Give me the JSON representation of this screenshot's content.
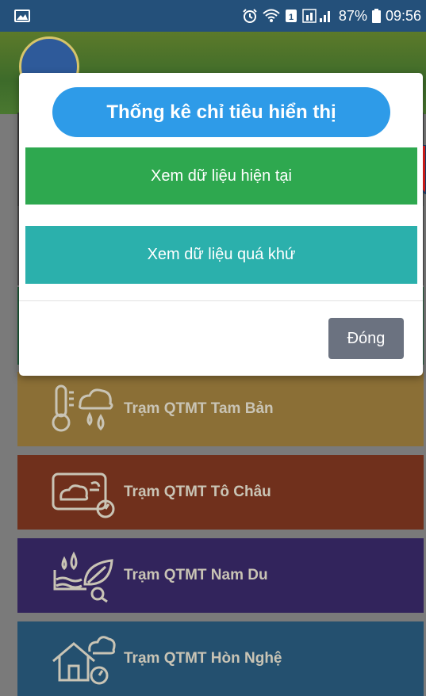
{
  "status_bar": {
    "battery": "87%",
    "time": "09:56",
    "icons": [
      "image-icon",
      "alarm-icon",
      "wifi-icon",
      "sim-icon",
      "signal-icon",
      "battery-icon"
    ]
  },
  "dialog": {
    "title": "Thống kê chỉ tiêu hiển thị",
    "btn_current": "Xem dữ liệu hiện tại",
    "btn_past": "Xem dữ liệu quá khứ",
    "btn_close": "Đóng"
  },
  "stations": [
    {
      "label": "Trạm QTMT Tam Bản",
      "icon": "weather-thermometer-icon",
      "color": "#a8843f"
    },
    {
      "label": "Trạm QTMT Tô Châu",
      "icon": "cloud-gauge-icon",
      "color": "#8c3c22"
    },
    {
      "label": "Trạm QTMT Nam Du",
      "icon": "water-leaf-icon",
      "color": "#3f2e72"
    },
    {
      "label": "Trạm QTMT Hòn Nghệ",
      "icon": "house-cloud-icon",
      "color": "#2c5f86"
    }
  ],
  "colors": {
    "status_bar": "#24507a",
    "title_pill": "#2e9be8",
    "btn_current": "#2ea84f",
    "btn_past": "#2bb0ac",
    "btn_close": "#6b7280"
  }
}
